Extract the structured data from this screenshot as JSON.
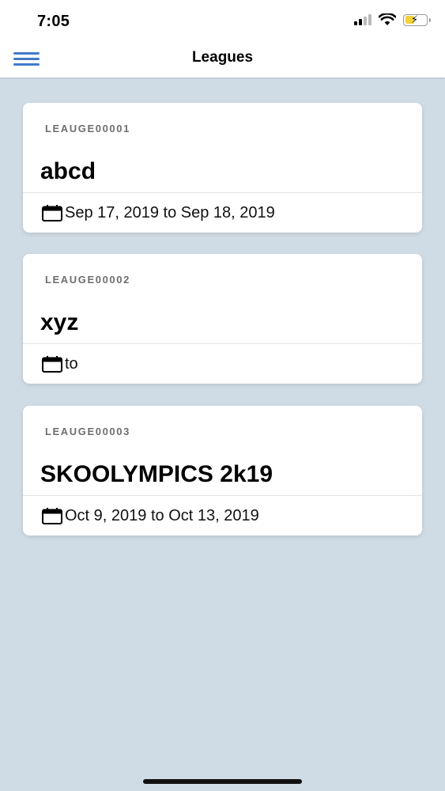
{
  "status_bar": {
    "time": "7:05",
    "icons": [
      "cellular-signal-icon",
      "wifi-icon",
      "battery-charging-icon"
    ]
  },
  "nav": {
    "menu_icon": "hamburger-menu-icon",
    "title": "Leagues"
  },
  "colors": {
    "background": "#cfdbe5",
    "accent": "#3f7cc9",
    "card": "#ffffff",
    "battery": "#f3d23a"
  },
  "leagues": [
    {
      "code": "LEAUGE00001",
      "name": "abcd",
      "dates": "Sep 17, 2019 to Sep 18, 2019",
      "icon": "calendar-icon"
    },
    {
      "code": "LEAUGE00002",
      "name": "xyz",
      "dates": "to",
      "icon": "calendar-icon"
    },
    {
      "code": "LEAUGE00003",
      "name": "SKOOLYMPICS 2k19",
      "dates": "Oct 9, 2019 to Oct 13, 2019",
      "icon": "calendar-icon"
    }
  ]
}
